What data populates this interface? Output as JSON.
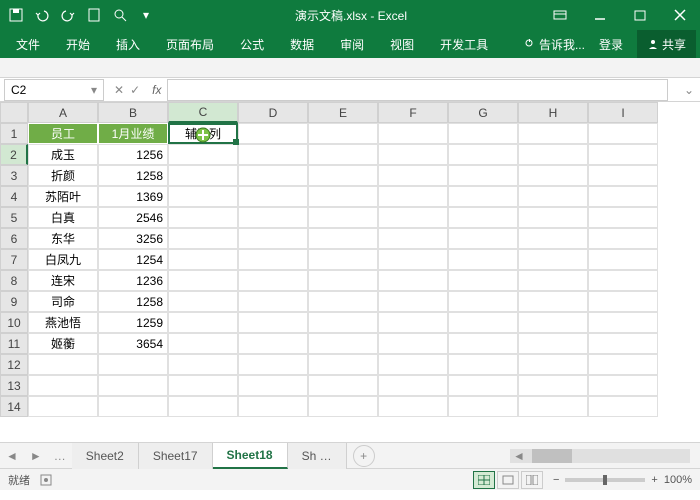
{
  "title": "演示文稿.xlsx - Excel",
  "tabs": [
    "文件",
    "开始",
    "插入",
    "页面布局",
    "公式",
    "数据",
    "审阅",
    "视图",
    "开发工具"
  ],
  "tell": "告诉我...",
  "login": "登录",
  "share": "共享",
  "namebox": "C2",
  "cols": [
    "A",
    "B",
    "C",
    "D",
    "E",
    "F",
    "G",
    "H",
    "I"
  ],
  "headers": {
    "a": "员工",
    "b": "1月业绩",
    "c": "辅助列"
  },
  "rows": [
    {
      "n": "成玉",
      "v": "1256"
    },
    {
      "n": "折颜",
      "v": "1258"
    },
    {
      "n": "苏陌叶",
      "v": "1369"
    },
    {
      "n": "白真",
      "v": "2546"
    },
    {
      "n": "东华",
      "v": "3256"
    },
    {
      "n": "白凤九",
      "v": "1254"
    },
    {
      "n": "连宋",
      "v": "1236"
    },
    {
      "n": "司命",
      "v": "1258"
    },
    {
      "n": "燕池悟",
      "v": "1259"
    },
    {
      "n": "姬蘅",
      "v": "3654"
    }
  ],
  "sheets": [
    "Sheet2",
    "Sheet17",
    "Sheet18",
    "Sh …"
  ],
  "activeSheet": 2,
  "status": "就绪",
  "zoom": "100%"
}
